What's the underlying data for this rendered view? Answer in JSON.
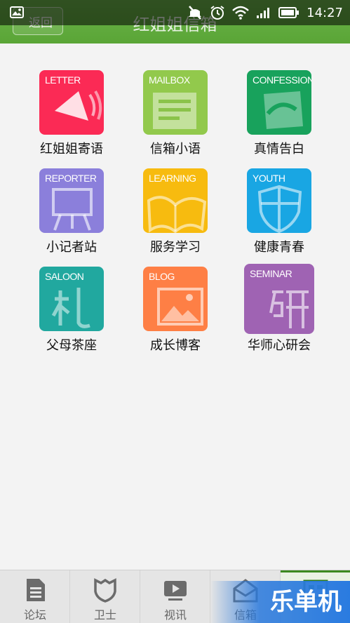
{
  "status_bar": {
    "time": "14:27"
  },
  "header": {
    "back_label": "返回",
    "title": "红姐姐信箱"
  },
  "tiles": [
    {
      "tag": "LETTER",
      "label": "红姐姐寄语",
      "color": "#fb2a55"
    },
    {
      "tag": "MAILBOX",
      "label": "信箱小语",
      "color": "#92c94c"
    },
    {
      "tag": "CONFESSIONS",
      "label": "真情告白",
      "color": "#18a25c"
    },
    {
      "tag": "REPORTER",
      "label": "小记者站",
      "color": "#8b7fdb"
    },
    {
      "tag": "LEARNING",
      "label": "服务学习",
      "color": "#f7bb0f"
    },
    {
      "tag": "YOUTH",
      "label": "健康青春",
      "color": "#19a6e3"
    },
    {
      "tag": "SALOON",
      "label": "父母茶座",
      "color": "#21a89f"
    },
    {
      "tag": "BLOG",
      "label": "成长博客",
      "color": "#fe7f45"
    },
    {
      "tag": "SEMINAR",
      "label": "华师心研会",
      "color": "#9f63b3"
    }
  ],
  "bottom_nav": [
    {
      "label": "论坛",
      "icon": "document-icon"
    },
    {
      "label": "卫士",
      "icon": "shield-icon"
    },
    {
      "label": "视讯",
      "icon": "video-icon"
    },
    {
      "label": "信箱",
      "icon": "mail-icon"
    },
    {
      "label": "",
      "icon": "grid-icon"
    }
  ],
  "watermark": "乐单机"
}
